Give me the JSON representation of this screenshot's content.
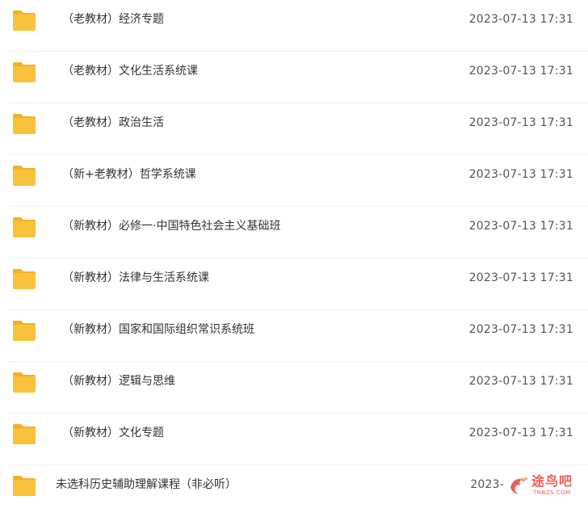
{
  "files": [
    {
      "name": "（老教材）经济专题",
      "date": "2023-07-13 17:31",
      "icon": "folder-icon"
    },
    {
      "name": "（老教材）文化生活系统课",
      "date": "2023-07-13 17:31",
      "icon": "folder-icon"
    },
    {
      "name": "（老教材）政治生活",
      "date": "2023-07-13 17:31",
      "icon": "folder-icon"
    },
    {
      "name": "（新+老教材）哲学系统课",
      "date": "2023-07-13 17:31",
      "icon": "folder-icon"
    },
    {
      "name": "（新教材）必修一·中国特色社会主义基础班",
      "date": "2023-07-13 17:31",
      "icon": "folder-icon"
    },
    {
      "name": "（新教材）法律与生活系统课",
      "date": "2023-07-13 17:31",
      "icon": "folder-icon"
    },
    {
      "name": "（新教材）国家和国际组织常识系统班",
      "date": "2023-07-13 17:31",
      "icon": "folder-icon"
    },
    {
      "name": "（新教材）逻辑与思维",
      "date": "2023-07-13 17:31",
      "icon": "folder-icon"
    },
    {
      "name": "（新教材）文化专题",
      "date": "2023-07-13 17:31",
      "icon": "folder-icon"
    },
    {
      "name": "未选科历史辅助理解课程（非必听）",
      "date": "2023-",
      "icon": "folder-icon"
    }
  ],
  "watermark": {
    "text": "途鸟吧",
    "subtext": "TNBZS.COM",
    "color": "#e8605a"
  },
  "colors": {
    "folder": "#f9c23c",
    "folder_tab": "#f5b125"
  }
}
